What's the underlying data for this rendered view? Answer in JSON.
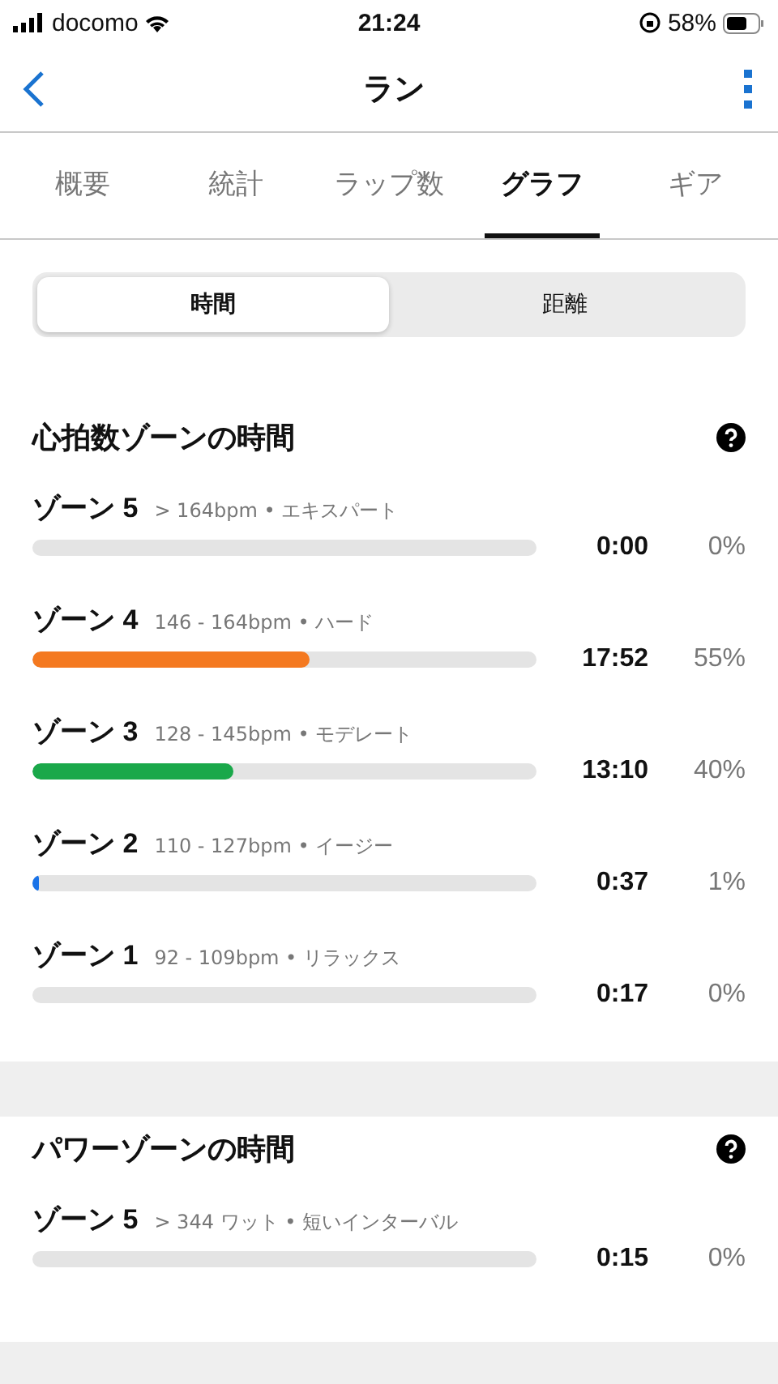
{
  "status_bar": {
    "carrier": "docomo",
    "time": "21:24",
    "battery": "58%"
  },
  "nav": {
    "title": "ラン"
  },
  "tabs": [
    {
      "label": "概要",
      "selected": false
    },
    {
      "label": "統計",
      "selected": false
    },
    {
      "label": "ラップ数",
      "selected": false
    },
    {
      "label": "グラフ",
      "selected": true
    },
    {
      "label": "ギア",
      "selected": false
    }
  ],
  "segments": [
    {
      "label": "時間",
      "selected": true
    },
    {
      "label": "距離",
      "selected": false
    }
  ],
  "sections": [
    {
      "title": "心拍数ゾーンの時間",
      "zones": [
        {
          "name": "ゾーン 5",
          "range": "> 164bpm • エキスパート",
          "time": "0:00",
          "percent": "0%"
        },
        {
          "name": "ゾーン 4",
          "range": "146 - 164bpm • ハード",
          "level": 0.55,
          "color": "#f47920",
          "time": "17:52",
          "percent": "55%"
        },
        {
          "name": "ゾーン 3",
          "range": "128 - 145bpm • モデレート",
          "level": 0.4,
          "color": "#1aa84a",
          "time": "13:10",
          "percent": "40%"
        },
        {
          "name": "ゾーン 2",
          "range": "110 - 127bpm • イージー",
          "level": 0.01,
          "color": "#1a73e8",
          "time": "0:37",
          "percent": "1%"
        },
        {
          "name": "ゾーン 1",
          "range": "92 - 109bpm • リラックス",
          "time": "0:17",
          "percent": "0%"
        }
      ]
    },
    {
      "title": "パワーゾーンの時間",
      "zones": [
        {
          "name": "ゾーン 5",
          "range": "> 344 ワット • 短いインターバル",
          "time": "0:15",
          "percent": "0%"
        }
      ]
    }
  ]
}
